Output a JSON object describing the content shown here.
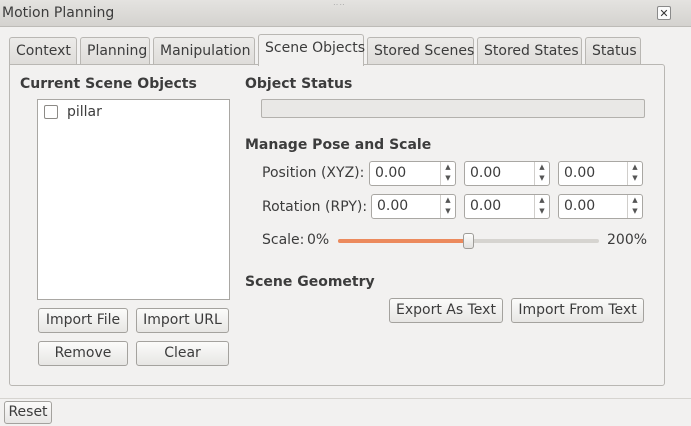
{
  "window": {
    "title": "Motion Planning",
    "close_glyph": "✕",
    "resize_grip": "‥‥"
  },
  "tabs": [
    {
      "label": "Context",
      "active": false
    },
    {
      "label": "Planning",
      "active": false
    },
    {
      "label": "Manipulation",
      "active": false
    },
    {
      "label": "Scene Objects",
      "active": true
    },
    {
      "label": "Stored Scenes",
      "active": false
    },
    {
      "label": "Stored States",
      "active": false
    },
    {
      "label": "Status",
      "active": false
    }
  ],
  "scene_objects": {
    "heading": "Current Scene Objects",
    "items": [
      {
        "label": "pillar",
        "checked": false
      }
    ],
    "buttons": {
      "import_file": "Import File",
      "import_url": "Import URL",
      "remove": "Remove",
      "clear": "Clear"
    }
  },
  "object_status": {
    "heading": "Object Status",
    "text": ""
  },
  "pose_scale": {
    "heading": "Manage Pose and Scale",
    "position": {
      "label": "Position (XYZ):",
      "values": [
        "0.00",
        "0.00",
        "0.00"
      ]
    },
    "rotation": {
      "label": "Rotation (RPY):",
      "values": [
        "0.00",
        "0.00",
        "0.00"
      ]
    },
    "scale": {
      "label": "Scale:",
      "min_label": "0%",
      "max_label": "200%",
      "value_fraction": 0.5
    },
    "spin_up_glyph": "▲",
    "spin_down_glyph": "▼"
  },
  "scene_geometry": {
    "heading": "Scene Geometry",
    "export_label": "Export As Text",
    "import_label": "Import From Text"
  },
  "footer": {
    "reset_label": "Reset"
  },
  "colors": {
    "accent": "#ec8a5d",
    "background": "#f2f1f0"
  }
}
